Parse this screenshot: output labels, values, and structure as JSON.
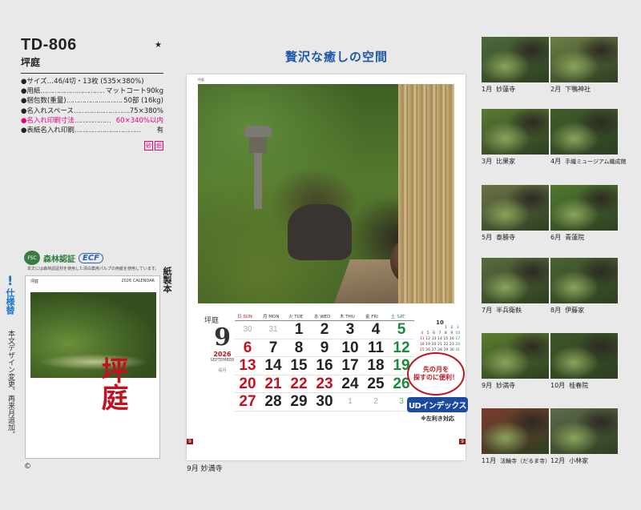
{
  "product": {
    "code": "TD-806",
    "name": "坪庭",
    "star": "★",
    "specs": [
      {
        "k": "●サイズ…46/4切・13枚 (535×380%)",
        "v": ""
      },
      {
        "k": "●用紙",
        "v": "マットコート90kg"
      },
      {
        "k": "●梱包数(重量)",
        "v": "50部 (16kg)"
      },
      {
        "k": "●名入れスペース",
        "v": "75×380%"
      },
      {
        "k": "●名入れ印刷寸法",
        "v": "60×340%以内",
        "pink": true
      },
      {
        "k": "●表紙名入れ印刷",
        "v": "有"
      }
    ],
    "stamps": [
      "砂",
      "紙"
    ]
  },
  "badges": {
    "fsc_logo": "FSC",
    "forest_cert": "森林認証",
    "ecf": "ECF",
    "paper_note": "本文には森林認証材を使用した漂白薬用パルプの用紙を使用しています。"
  },
  "paper_label": "紙製本",
  "spec_change": {
    "mark": "!",
    "title": "仕様替",
    "body": "本文デザイン変更、再来月追加。"
  },
  "cover": {
    "hdr_left": "坪庭",
    "hdr_mid": "2026 CALENDAR",
    "title": "坪庭"
  },
  "copyright": "©",
  "headline": "贅沢な癒しの空間",
  "calendar": {
    "month_jp": "坪庭",
    "month_num": "9",
    "year": "2026",
    "month_en": "SEPTEMBER",
    "sub": "長月",
    "dow": [
      "日 SUN",
      "月 MON",
      "火 TUE",
      "水 WED",
      "木 THU",
      "金 FRI",
      "土 SAT"
    ],
    "days": [
      {
        "t": "30",
        "c": "dim"
      },
      {
        "t": "31",
        "c": "dim"
      },
      {
        "t": "1",
        "c": ""
      },
      {
        "t": "2",
        "c": ""
      },
      {
        "t": "3",
        "c": ""
      },
      {
        "t": "4",
        "c": ""
      },
      {
        "t": "5",
        "c": "sat"
      },
      {
        "t": "6",
        "c": "sun"
      },
      {
        "t": "7",
        "c": ""
      },
      {
        "t": "8",
        "c": ""
      },
      {
        "t": "9",
        "c": ""
      },
      {
        "t": "10",
        "c": ""
      },
      {
        "t": "11",
        "c": ""
      },
      {
        "t": "12",
        "c": "sat"
      },
      {
        "t": "13",
        "c": "sun"
      },
      {
        "t": "14",
        "c": ""
      },
      {
        "t": "15",
        "c": ""
      },
      {
        "t": "16",
        "c": ""
      },
      {
        "t": "17",
        "c": ""
      },
      {
        "t": "18",
        "c": ""
      },
      {
        "t": "19",
        "c": "sat"
      },
      {
        "t": "20",
        "c": "sun"
      },
      {
        "t": "21",
        "c": "hol"
      },
      {
        "t": "22",
        "c": "hol"
      },
      {
        "t": "23",
        "c": "hol"
      },
      {
        "t": "24",
        "c": ""
      },
      {
        "t": "25",
        "c": ""
      },
      {
        "t": "26",
        "c": "sat"
      },
      {
        "t": "27",
        "c": "sun"
      },
      {
        "t": "28",
        "c": ""
      },
      {
        "t": "29",
        "c": ""
      },
      {
        "t": "30",
        "c": ""
      },
      {
        "t": "1",
        "c": "dim"
      },
      {
        "t": "2",
        "c": "dim"
      },
      {
        "t": "3",
        "c": "dimg"
      }
    ],
    "mini_oct": {
      "label": "10",
      "days": [
        "",
        "",
        "",
        "",
        "1",
        "2",
        "3",
        "4",
        "5",
        "6",
        "7",
        "8",
        "9",
        "10",
        "11",
        "12",
        "13",
        "14",
        "15",
        "16",
        "17",
        "18",
        "19",
        "20",
        "21",
        "22",
        "23",
        "24",
        "25",
        "26",
        "27",
        "28",
        "29",
        "30",
        "31"
      ]
    },
    "mini_nov": {
      "label": "11",
      "days": [
        "1",
        "2",
        "3",
        "4",
        "5",
        "6",
        "7",
        "8",
        "9",
        "10",
        "11",
        "12",
        "13",
        "14",
        "15",
        "16",
        "17",
        "18",
        "19",
        "20",
        "21",
        "22",
        "23",
        "24",
        "25",
        "26",
        "27",
        "28",
        "29",
        "30"
      ]
    },
    "page_left": "9",
    "page_right": "9"
  },
  "ud_badge": {
    "bubble_l1": "先の月を",
    "bubble_l2": "探すのに便利！",
    "label": "UDインデックス",
    "note": "※左利き対応"
  },
  "main_caption": "9月 妙満寺",
  "thumbnails": [
    {
      "m": "1月",
      "n": "妙蓮寺",
      "col": "#4d6a3a"
    },
    {
      "m": "2月",
      "n": "下鴨神社",
      "col": "#6d7f46"
    },
    {
      "m": "3月",
      "n": "比果家",
      "col": "#5a7a35"
    },
    {
      "m": "4月",
      "n": "手織ミュージアム織成館",
      "col": "#3f5e2b"
    },
    {
      "m": "5月",
      "n": "泰勝寺",
      "col": "#6b7346"
    },
    {
      "m": "6月",
      "n": "青蓮院",
      "col": "#4f7a2e"
    },
    {
      "m": "7月",
      "n": "半兵衛麸",
      "col": "#5b6b3d"
    },
    {
      "m": "8月",
      "n": "伊藤家",
      "col": "#4a6232"
    },
    {
      "m": "9月",
      "n": "妙満寺",
      "col": "#5c7d30"
    },
    {
      "m": "10月",
      "n": "桂春院",
      "col": "#3d5628"
    },
    {
      "m": "11月",
      "n": "法輪寺（だるま寺）",
      "col": "#7a3b2e"
    },
    {
      "m": "12月",
      "n": "小林家",
      "col": "#5d6a4b"
    }
  ]
}
